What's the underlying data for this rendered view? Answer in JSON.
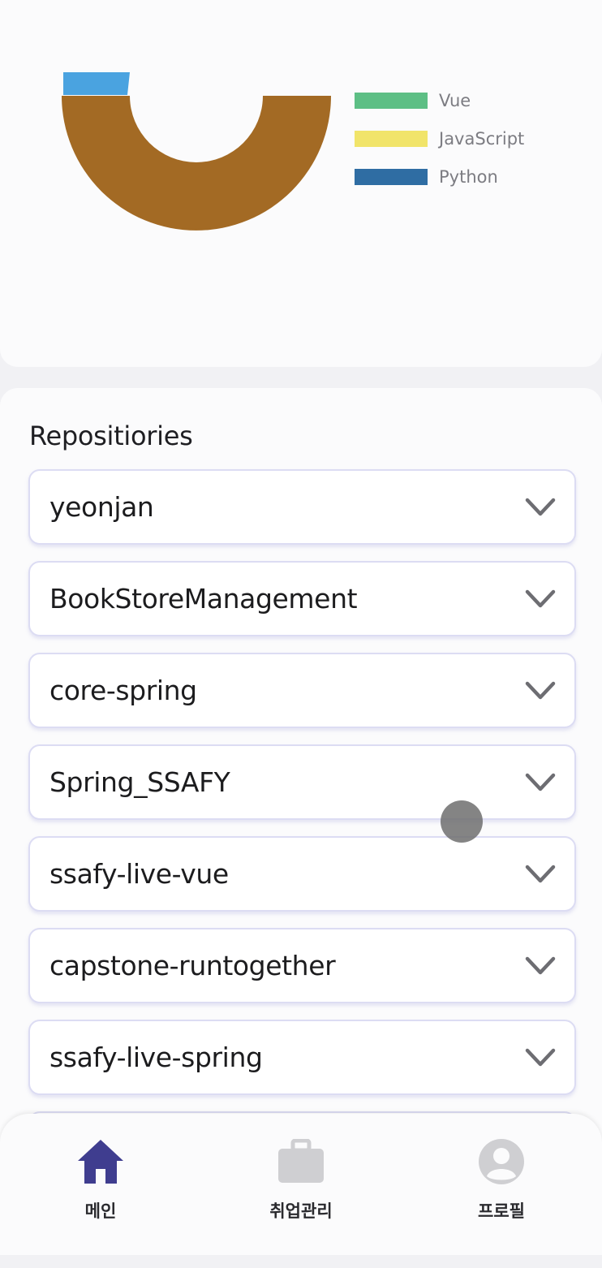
{
  "chart_data": {
    "type": "pie",
    "variant": "donut",
    "legend": [
      "Vue",
      "JavaScript",
      "Python"
    ],
    "legend_colors": [
      "#5dbf85",
      "#f1e46a",
      "#2f6da3"
    ],
    "slice_colors": {
      "main": "#a36a24",
      "small": "#4aa3e0"
    },
    "legend_position": "right"
  },
  "repositories": {
    "title": "Repositiories",
    "items": [
      {
        "name": "yeonjan"
      },
      {
        "name": "BookStoreManagement"
      },
      {
        "name": "core-spring"
      },
      {
        "name": "Spring_SSAFY"
      },
      {
        "name": "ssafy-live-vue"
      },
      {
        "name": "capstone-runtogether"
      },
      {
        "name": "ssafy-live-spring"
      }
    ]
  },
  "nav": {
    "items": [
      {
        "label": "메인",
        "icon": "home-icon",
        "active": true
      },
      {
        "label": "취업관리",
        "icon": "briefcase-icon",
        "active": false
      },
      {
        "label": "프로필",
        "icon": "profile-icon",
        "active": false
      }
    ]
  },
  "colors": {
    "accent": "#3f3d8f",
    "inactive_icon": "#cfcfd2",
    "back_arrow": "#6b6b8a",
    "item_border": "#dcdcf3"
  }
}
